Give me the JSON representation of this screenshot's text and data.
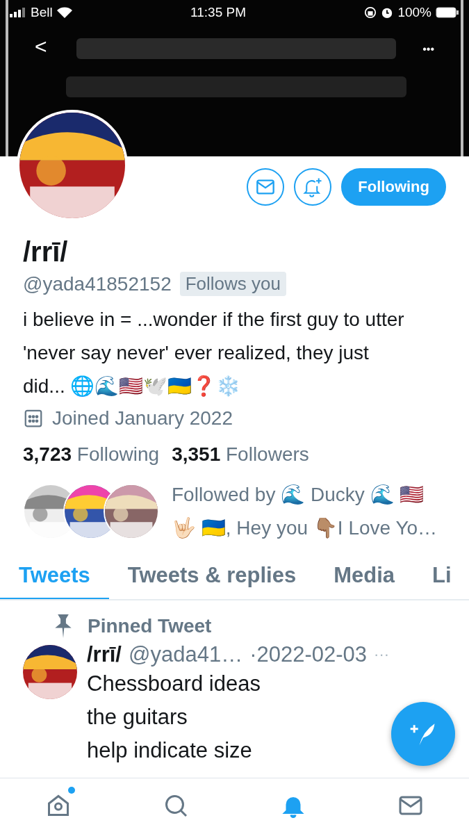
{
  "status_bar": {
    "carrier": "Bell",
    "time": "11:35 PM",
    "battery": "100%"
  },
  "banner": {
    "kind": "picture",
    "back": "<",
    "more": "•••"
  },
  "actions": {
    "follow": "Following",
    "following": true
  },
  "profile": {
    "name": "/rrī/",
    "handle": "@yada41852152",
    "follows_you": "Follows you",
    "bio": "i believe in = ...wonder if the first guy to utter 'never say never' ever realized, they just did... 🌐🌊🇺🇸🕊️🇺🇦❓❄️",
    "joined": "Joined January 2022"
  },
  "counts": [
    "**3,723** Following",
    "**3,351** Followers"
  ],
  "followed_by": "Followed by 🌊 Ducky 🌊 🇺🇸 🤟🏻 🇺🇦, Hey you 👇🏽I Love Yo…",
  "tabs": [
    {
      "label": "Tweets",
      "selected": true
    },
    {
      "label": "Tweets & replies",
      "selected": false
    },
    {
      "label": "Media",
      "selected": false
    },
    {
      "label": "Li",
      "selected": false
    }
  ],
  "pinned": {
    "label": "Pinned Tweet",
    "name": "/rrī/",
    "handle": "@yada41…",
    "date": "·2022-02-03",
    "more": "···",
    "lines": [
      "Chessboard ideas",
      "the guitars",
      "help indicate size"
    ]
  },
  "nav": [
    {
      "kind": "home",
      "selected": false,
      "badge": true
    },
    {
      "kind": "search",
      "selected": false,
      "badge": false
    },
    {
      "kind": "bell",
      "selected": true,
      "badge": false
    },
    {
      "kind": "mail",
      "selected": false,
      "badge": false
    }
  ]
}
